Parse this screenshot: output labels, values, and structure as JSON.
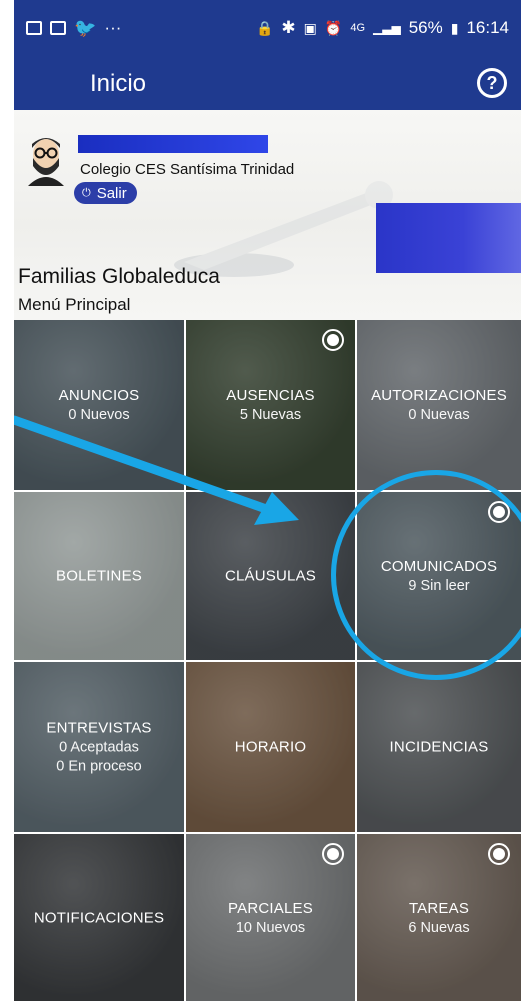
{
  "statusbar": {
    "left_more": "···",
    "battery_percent": "56%",
    "time": "16:14",
    "network": "4G"
  },
  "appbar": {
    "title": "Inicio",
    "help_symbol": "?"
  },
  "header": {
    "school": "Colegio CES Santísima Trinidad",
    "logout_label": "Salir",
    "app_name": "Familias Globaleduca",
    "menu_title": "Menú Principal"
  },
  "tiles": [
    {
      "label": "ANUNCIOS",
      "sub": [
        "0 Nuevos"
      ],
      "badge": false,
      "bg": "#6b7b84"
    },
    {
      "label": "AUSENCIAS",
      "sub": [
        "5 Nuevas"
      ],
      "badge": true,
      "bg": "#4a5a3d"
    },
    {
      "label": "AUTORIZACIONES",
      "sub": [
        "0 Nuevas"
      ],
      "badge": false,
      "bg": "#9a9ea3"
    },
    {
      "label": "BOLETINES",
      "sub": [],
      "badge": false,
      "bg": "#e9f1ec"
    },
    {
      "label": "CLÁUSULAS",
      "sub": [],
      "badge": false,
      "bg": "#5c6066"
    },
    {
      "label": "COMUNICADOS",
      "sub": [
        "9 Sin leer"
      ],
      "badge": true,
      "bg": "#76858d"
    },
    {
      "label": "ENTREVISTAS",
      "sub": [
        "0 Aceptadas",
        "0 En proceso"
      ],
      "badge": false,
      "bg": "#7f8f98"
    },
    {
      "label": "HORARIO",
      "sub": [],
      "badge": false,
      "bg": "#a47b58"
    },
    {
      "label": "INCIDENCIAS",
      "sub": [],
      "badge": false,
      "bg": "#76787a"
    },
    {
      "label": "NOTIFICACIONES",
      "sub": [],
      "badge": false,
      "bg": "#4a4a4c"
    },
    {
      "label": "PARCIALES",
      "sub": [
        "10 Nuevos"
      ],
      "badge": true,
      "bg": "#a9a9a9"
    },
    {
      "label": "TAREAS",
      "sub": [
        "6 Nuevas"
      ],
      "badge": true,
      "bg": "#9b8676"
    }
  ],
  "colors": {
    "appbar": "#1f3a8f",
    "annotation": "#19a6e6",
    "logout": "#2c3ea8"
  }
}
